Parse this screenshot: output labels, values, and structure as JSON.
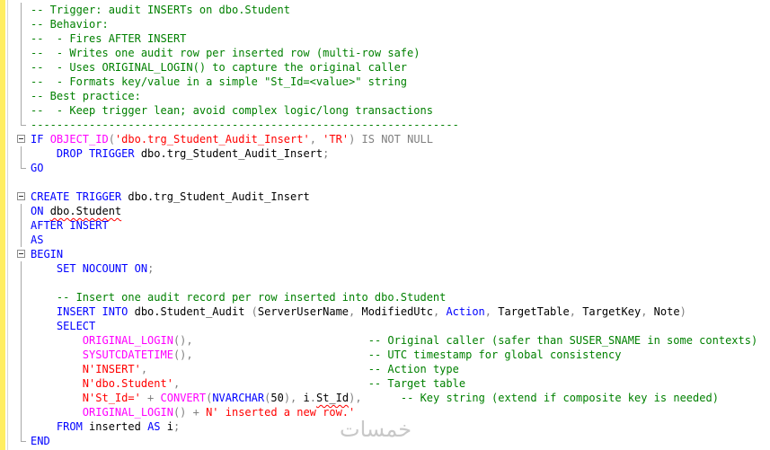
{
  "editor": {
    "language": "T-SQL",
    "lines": [
      {
        "outline": "line",
        "tokens": [
          {
            "c": "cm",
            "t": "-- Trigger: audit INSERTs on dbo.Student"
          }
        ]
      },
      {
        "outline": "line",
        "tokens": [
          {
            "c": "cm",
            "t": "-- Behavior:"
          }
        ]
      },
      {
        "outline": "line",
        "tokens": [
          {
            "c": "cm",
            "t": "--  - Fires AFTER INSERT"
          }
        ]
      },
      {
        "outline": "line",
        "tokens": [
          {
            "c": "cm",
            "t": "--  - Writes one audit row per inserted row (multi-row safe)"
          }
        ]
      },
      {
        "outline": "line",
        "tokens": [
          {
            "c": "cm",
            "t": "--  - Uses ORIGINAL_LOGIN() to capture the original caller"
          }
        ]
      },
      {
        "outline": "line",
        "tokens": [
          {
            "c": "cm",
            "t": "--  - Formats key/value in a simple \"St_Id=<value>\" string"
          }
        ]
      },
      {
        "outline": "line",
        "tokens": [
          {
            "c": "cm",
            "t": "-- Best practice:"
          }
        ]
      },
      {
        "outline": "line",
        "tokens": [
          {
            "c": "cm",
            "t": "--  - Keep trigger lean; avoid complex logic/long transactions"
          }
        ]
      },
      {
        "outline": "tail",
        "tokens": [
          {
            "c": "cm",
            "t": "------------------------------------------------------------------"
          }
        ]
      },
      {
        "outline": "fold",
        "tokens": [
          {
            "c": "kw",
            "t": "IF "
          },
          {
            "c": "fn",
            "t": "OBJECT_ID"
          },
          {
            "c": "op",
            "t": "("
          },
          {
            "c": "st",
            "t": "'dbo.trg_Student_Audit_Insert'"
          },
          {
            "c": "op",
            "t": ", "
          },
          {
            "c": "st",
            "t": "'TR'"
          },
          {
            "c": "op",
            "t": ") "
          },
          {
            "c": "op",
            "t": "IS NOT NULL"
          }
        ]
      },
      {
        "outline": "line",
        "tokens": [
          {
            "c": "id",
            "t": "    "
          },
          {
            "c": "kw",
            "t": "DROP TRIGGER "
          },
          {
            "c": "id",
            "t": "dbo.trg_Student_Audit_Insert"
          },
          {
            "c": "op",
            "t": ";"
          }
        ]
      },
      {
        "outline": "tail",
        "tokens": [
          {
            "c": "kw",
            "t": "GO"
          }
        ]
      },
      {
        "outline": "none",
        "tokens": []
      },
      {
        "outline": "fold",
        "tokens": [
          {
            "c": "kw",
            "t": "CREATE TRIGGER "
          },
          {
            "c": "id",
            "t": "dbo.trg_Student_Audit_Insert"
          }
        ]
      },
      {
        "outline": "line",
        "tokens": [
          {
            "c": "kw",
            "t": "ON "
          },
          {
            "c": "id",
            "t": "dbo.Student",
            "squig": true
          }
        ]
      },
      {
        "outline": "line",
        "tokens": [
          {
            "c": "kw",
            "t": "AFTER INSERT"
          }
        ]
      },
      {
        "outline": "line",
        "tokens": [
          {
            "c": "kw",
            "t": "AS"
          }
        ]
      },
      {
        "outline": "fold",
        "tokens": [
          {
            "c": "kw",
            "t": "BEGIN"
          }
        ]
      },
      {
        "outline": "line",
        "tokens": [
          {
            "c": "id",
            "t": "    "
          },
          {
            "c": "kw",
            "t": "SET NOCOUNT ON"
          },
          {
            "c": "op",
            "t": ";"
          }
        ]
      },
      {
        "outline": "line",
        "tokens": []
      },
      {
        "outline": "line",
        "tokens": [
          {
            "c": "id",
            "t": "    "
          },
          {
            "c": "cm",
            "t": "-- Insert one audit record per row inserted into dbo.Student"
          }
        ]
      },
      {
        "outline": "line",
        "tokens": [
          {
            "c": "id",
            "t": "    "
          },
          {
            "c": "kw",
            "t": "INSERT INTO "
          },
          {
            "c": "id",
            "t": "dbo.Student_Audit "
          },
          {
            "c": "op",
            "t": "("
          },
          {
            "c": "id",
            "t": "ServerUserName"
          },
          {
            "c": "op",
            "t": ", "
          },
          {
            "c": "id",
            "t": "ModifiedUtc"
          },
          {
            "c": "op",
            "t": ", "
          },
          {
            "c": "kw",
            "t": "Action"
          },
          {
            "c": "op",
            "t": ", "
          },
          {
            "c": "id",
            "t": "TargetTable"
          },
          {
            "c": "op",
            "t": ", "
          },
          {
            "c": "id",
            "t": "TargetKey"
          },
          {
            "c": "op",
            "t": ", "
          },
          {
            "c": "id",
            "t": "Note"
          },
          {
            "c": "op",
            "t": ")"
          }
        ]
      },
      {
        "outline": "line",
        "tokens": [
          {
            "c": "id",
            "t": "    "
          },
          {
            "c": "kw",
            "t": "SELECT"
          }
        ]
      },
      {
        "outline": "line",
        "tokens": [
          {
            "c": "id",
            "t": "        "
          },
          {
            "c": "fn",
            "t": "ORIGINAL_LOGIN"
          },
          {
            "c": "op",
            "t": "(),"
          },
          {
            "c": "id",
            "t": "                           "
          },
          {
            "c": "cm",
            "t": "-- Original caller (safer than SUSER_SNAME in some contexts)"
          }
        ]
      },
      {
        "outline": "line",
        "tokens": [
          {
            "c": "id",
            "t": "        "
          },
          {
            "c": "fn",
            "t": "SYSUTCDATETIME"
          },
          {
            "c": "op",
            "t": "(),"
          },
          {
            "c": "id",
            "t": "                           "
          },
          {
            "c": "cm",
            "t": "-- UTC timestamp for global consistency"
          }
        ]
      },
      {
        "outline": "line",
        "tokens": [
          {
            "c": "id",
            "t": "        "
          },
          {
            "c": "st",
            "t": "N'INSERT'"
          },
          {
            "c": "op",
            "t": ","
          },
          {
            "c": "id",
            "t": "                                  "
          },
          {
            "c": "cm",
            "t": "-- Action type"
          }
        ]
      },
      {
        "outline": "line",
        "tokens": [
          {
            "c": "id",
            "t": "        "
          },
          {
            "c": "st",
            "t": "N'dbo.Student'"
          },
          {
            "c": "op",
            "t": ","
          },
          {
            "c": "id",
            "t": "                             "
          },
          {
            "c": "cm",
            "t": "-- Target table"
          }
        ]
      },
      {
        "outline": "line",
        "tokens": [
          {
            "c": "id",
            "t": "        "
          },
          {
            "c": "st",
            "t": "N'St_Id='"
          },
          {
            "c": "op",
            "t": " + "
          },
          {
            "c": "fn",
            "t": "CONVERT"
          },
          {
            "c": "op",
            "t": "("
          },
          {
            "c": "kw",
            "t": "NVARCHAR"
          },
          {
            "c": "op",
            "t": "("
          },
          {
            "c": "id",
            "t": "50"
          },
          {
            "c": "op",
            "t": "), "
          },
          {
            "c": "id",
            "t": "i"
          },
          {
            "c": "op",
            "t": "."
          },
          {
            "c": "id",
            "t": "St_Id",
            "squig": true
          },
          {
            "c": "op",
            "t": "),"
          },
          {
            "c": "id",
            "t": "      "
          },
          {
            "c": "cm",
            "t": "-- Key string (extend if composite key is needed)"
          }
        ]
      },
      {
        "outline": "line",
        "tokens": [
          {
            "c": "id",
            "t": "        "
          },
          {
            "c": "fn",
            "t": "ORIGINAL_LOGIN"
          },
          {
            "c": "op",
            "t": "() + "
          },
          {
            "c": "st",
            "t": "N' inserted a new row.'"
          }
        ]
      },
      {
        "outline": "line",
        "tokens": [
          {
            "c": "id",
            "t": "    "
          },
          {
            "c": "kw",
            "t": "FROM "
          },
          {
            "c": "id",
            "t": "inserted "
          },
          {
            "c": "kw",
            "t": "AS "
          },
          {
            "c": "id",
            "t": "i"
          },
          {
            "c": "op",
            "t": ";"
          }
        ]
      },
      {
        "outline": "tail",
        "tokens": [
          {
            "c": "kw",
            "t": "END"
          }
        ]
      }
    ]
  },
  "watermark": {
    "text": "خمسات"
  }
}
